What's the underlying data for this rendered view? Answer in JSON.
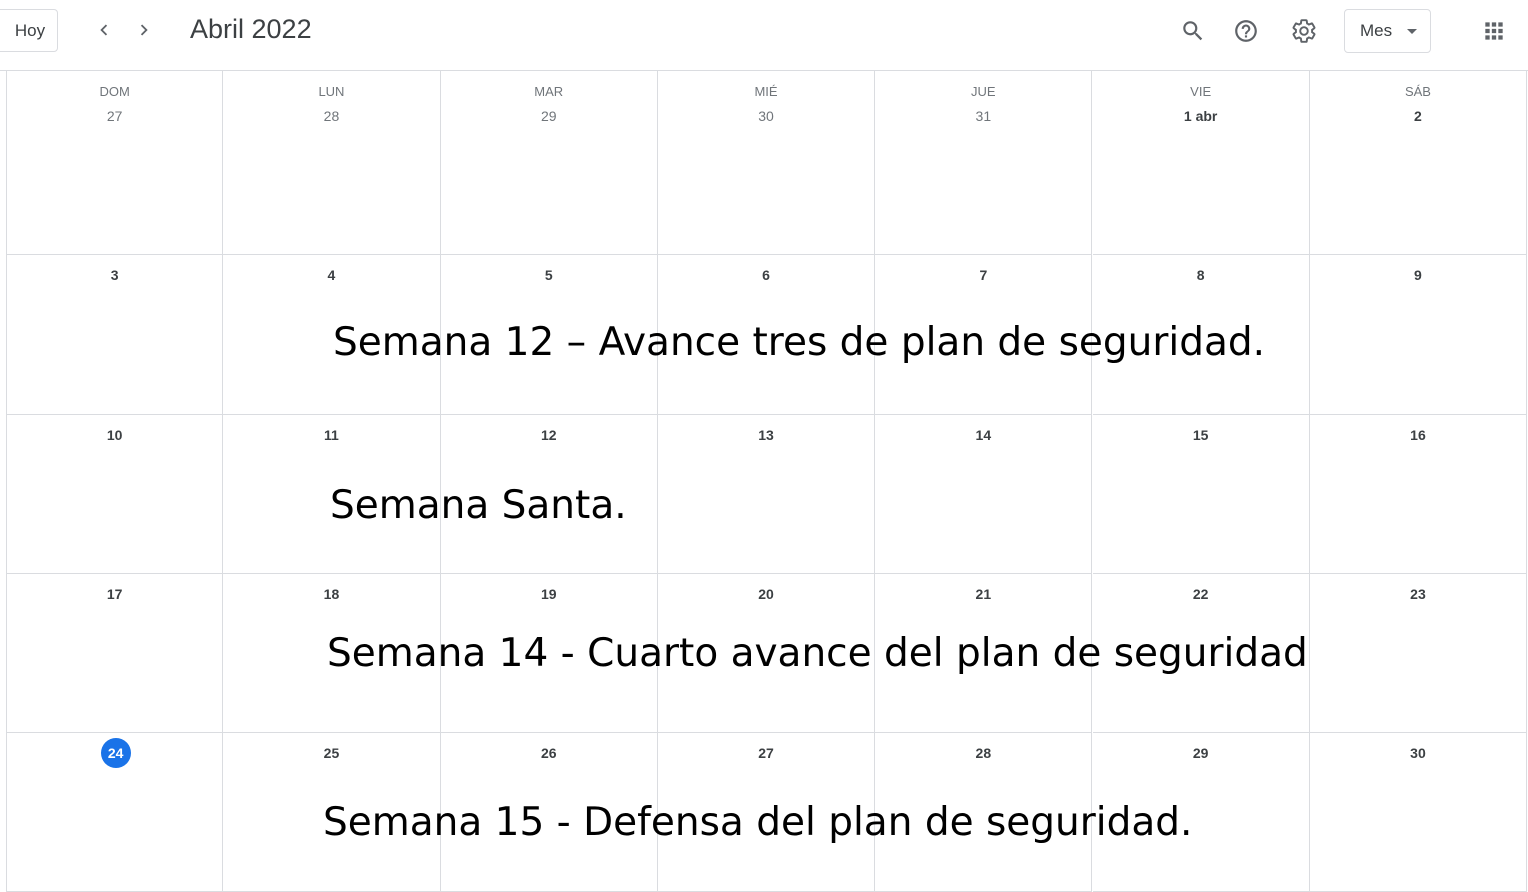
{
  "toolbar": {
    "today_label": "Hoy",
    "prev_icon": "chevron-left-icon",
    "next_icon": "chevron-right-icon",
    "month_title": "Abril 2022",
    "search_icon": "search-icon",
    "help_icon": "help-icon",
    "settings_icon": "gear-icon",
    "view_label": "Mes",
    "apps_icon": "apps-grid-icon"
  },
  "weekdays": [
    "DOM",
    "LUN",
    "MAR",
    "MIÉ",
    "JUE",
    "VIE",
    "SÁB"
  ],
  "weeks": [
    [
      "27",
      "28",
      "29",
      "30",
      "31",
      "1 abr",
      "2"
    ],
    [
      "3",
      "4",
      "5",
      "6",
      "7",
      "8",
      "9"
    ],
    [
      "10",
      "11",
      "12",
      "13",
      "14",
      "15",
      "16"
    ],
    [
      "17",
      "18",
      "19",
      "20",
      "21",
      "22",
      "23"
    ],
    [
      "24",
      "25",
      "26",
      "27",
      "28",
      "29",
      "30"
    ]
  ],
  "today": "24",
  "notes": [
    "Semana 12 – Avance tres de plan de seguridad.",
    "Semana Santa.",
    "Semana 14 - Cuarto avance del plan de seguridad",
    "Semana 15 - Defensa del plan de seguridad."
  ],
  "colors": {
    "accent": "#1a73e8",
    "border": "#dadce0",
    "text": "#3c4043",
    "muted": "#70757a"
  }
}
